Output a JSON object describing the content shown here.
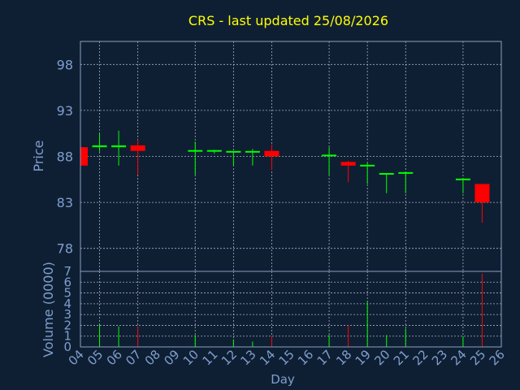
{
  "colors": {
    "background": "#0f1f33",
    "title": "#ffff00",
    "axis_text": "#7f9fcf",
    "frame": "#8aa0c0",
    "grid": "#c0c8d8",
    "up": "#00ff00",
    "down": "#ff0000"
  },
  "chart_data": {
    "type": "candlestick",
    "title": "CRS - last updated 25/08/2026",
    "price_panel": {
      "ylabel": "Price",
      "ylim": [
        75.5,
        100.5
      ],
      "yticks": [
        78,
        83,
        88,
        93,
        98
      ]
    },
    "volume_panel": {
      "ylabel": "Volume (0000)",
      "ylim": [
        0,
        7
      ],
      "yticks": [
        0,
        1,
        2,
        3,
        4,
        5,
        6,
        7
      ]
    },
    "xlabel": "Day",
    "xlim": [
      4,
      26
    ],
    "xticks": [
      "04",
      "05",
      "06",
      "07",
      "08",
      "09",
      "10",
      "11",
      "12",
      "13",
      "14",
      "15",
      "16",
      "17",
      "18",
      "19",
      "20",
      "21",
      "22",
      "23",
      "24",
      "25",
      "26"
    ],
    "vertical_grid_days": [
      5,
      7,
      10,
      12,
      14,
      17,
      19,
      21,
      24
    ],
    "grid": true,
    "candles": [
      {
        "day": 4,
        "open": 89.0,
        "high": 89.3,
        "low": 87.0,
        "close": 87.0,
        "volume": 0.0
      },
      {
        "day": 5,
        "open": 89.0,
        "high": 90.5,
        "low": 88.5,
        "close": 89.2,
        "volume": 2.1
      },
      {
        "day": 6,
        "open": 89.0,
        "high": 90.8,
        "low": 87.0,
        "close": 89.2,
        "volume": 1.9
      },
      {
        "day": 7,
        "open": 89.2,
        "high": 89.8,
        "low": 86.0,
        "close": 88.6,
        "volume": 1.9
      },
      {
        "day": 10,
        "open": 88.5,
        "high": 89.6,
        "low": 86.0,
        "close": 88.6,
        "volume": 1.1
      },
      {
        "day": 11,
        "open": 88.5,
        "high": 88.7,
        "low": 88.3,
        "close": 88.6,
        "volume": 0.0
      },
      {
        "day": 12,
        "open": 88.4,
        "high": 88.6,
        "low": 87.0,
        "close": 88.5,
        "volume": 0.7
      },
      {
        "day": 13,
        "open": 88.4,
        "high": 88.8,
        "low": 87.0,
        "close": 88.5,
        "volume": 0.5
      },
      {
        "day": 14,
        "open": 88.6,
        "high": 89.3,
        "low": 86.5,
        "close": 88.0,
        "volume": 1.0
      },
      {
        "day": 17,
        "open": 88.0,
        "high": 89.0,
        "low": 86.0,
        "close": 88.1,
        "volume": 1.1
      },
      {
        "day": 18,
        "open": 87.4,
        "high": 87.5,
        "low": 85.2,
        "close": 87.0,
        "volume": 2.0
      },
      {
        "day": 19,
        "open": 86.9,
        "high": 87.3,
        "low": 85.0,
        "close": 87.0,
        "volume": 4.2
      },
      {
        "day": 20,
        "open": 86.0,
        "high": 86.2,
        "low": 84.0,
        "close": 86.1,
        "volume": 1.1
      },
      {
        "day": 21,
        "open": 86.1,
        "high": 86.3,
        "low": 84.0,
        "close": 86.2,
        "volume": 1.7
      },
      {
        "day": 24,
        "open": 85.4,
        "high": 85.6,
        "low": 84.0,
        "close": 85.5,
        "volume": 1.0
      },
      {
        "day": 25,
        "open": 85.0,
        "high": 85.0,
        "low": 80.8,
        "close": 83.0,
        "volume": 6.8
      }
    ]
  }
}
